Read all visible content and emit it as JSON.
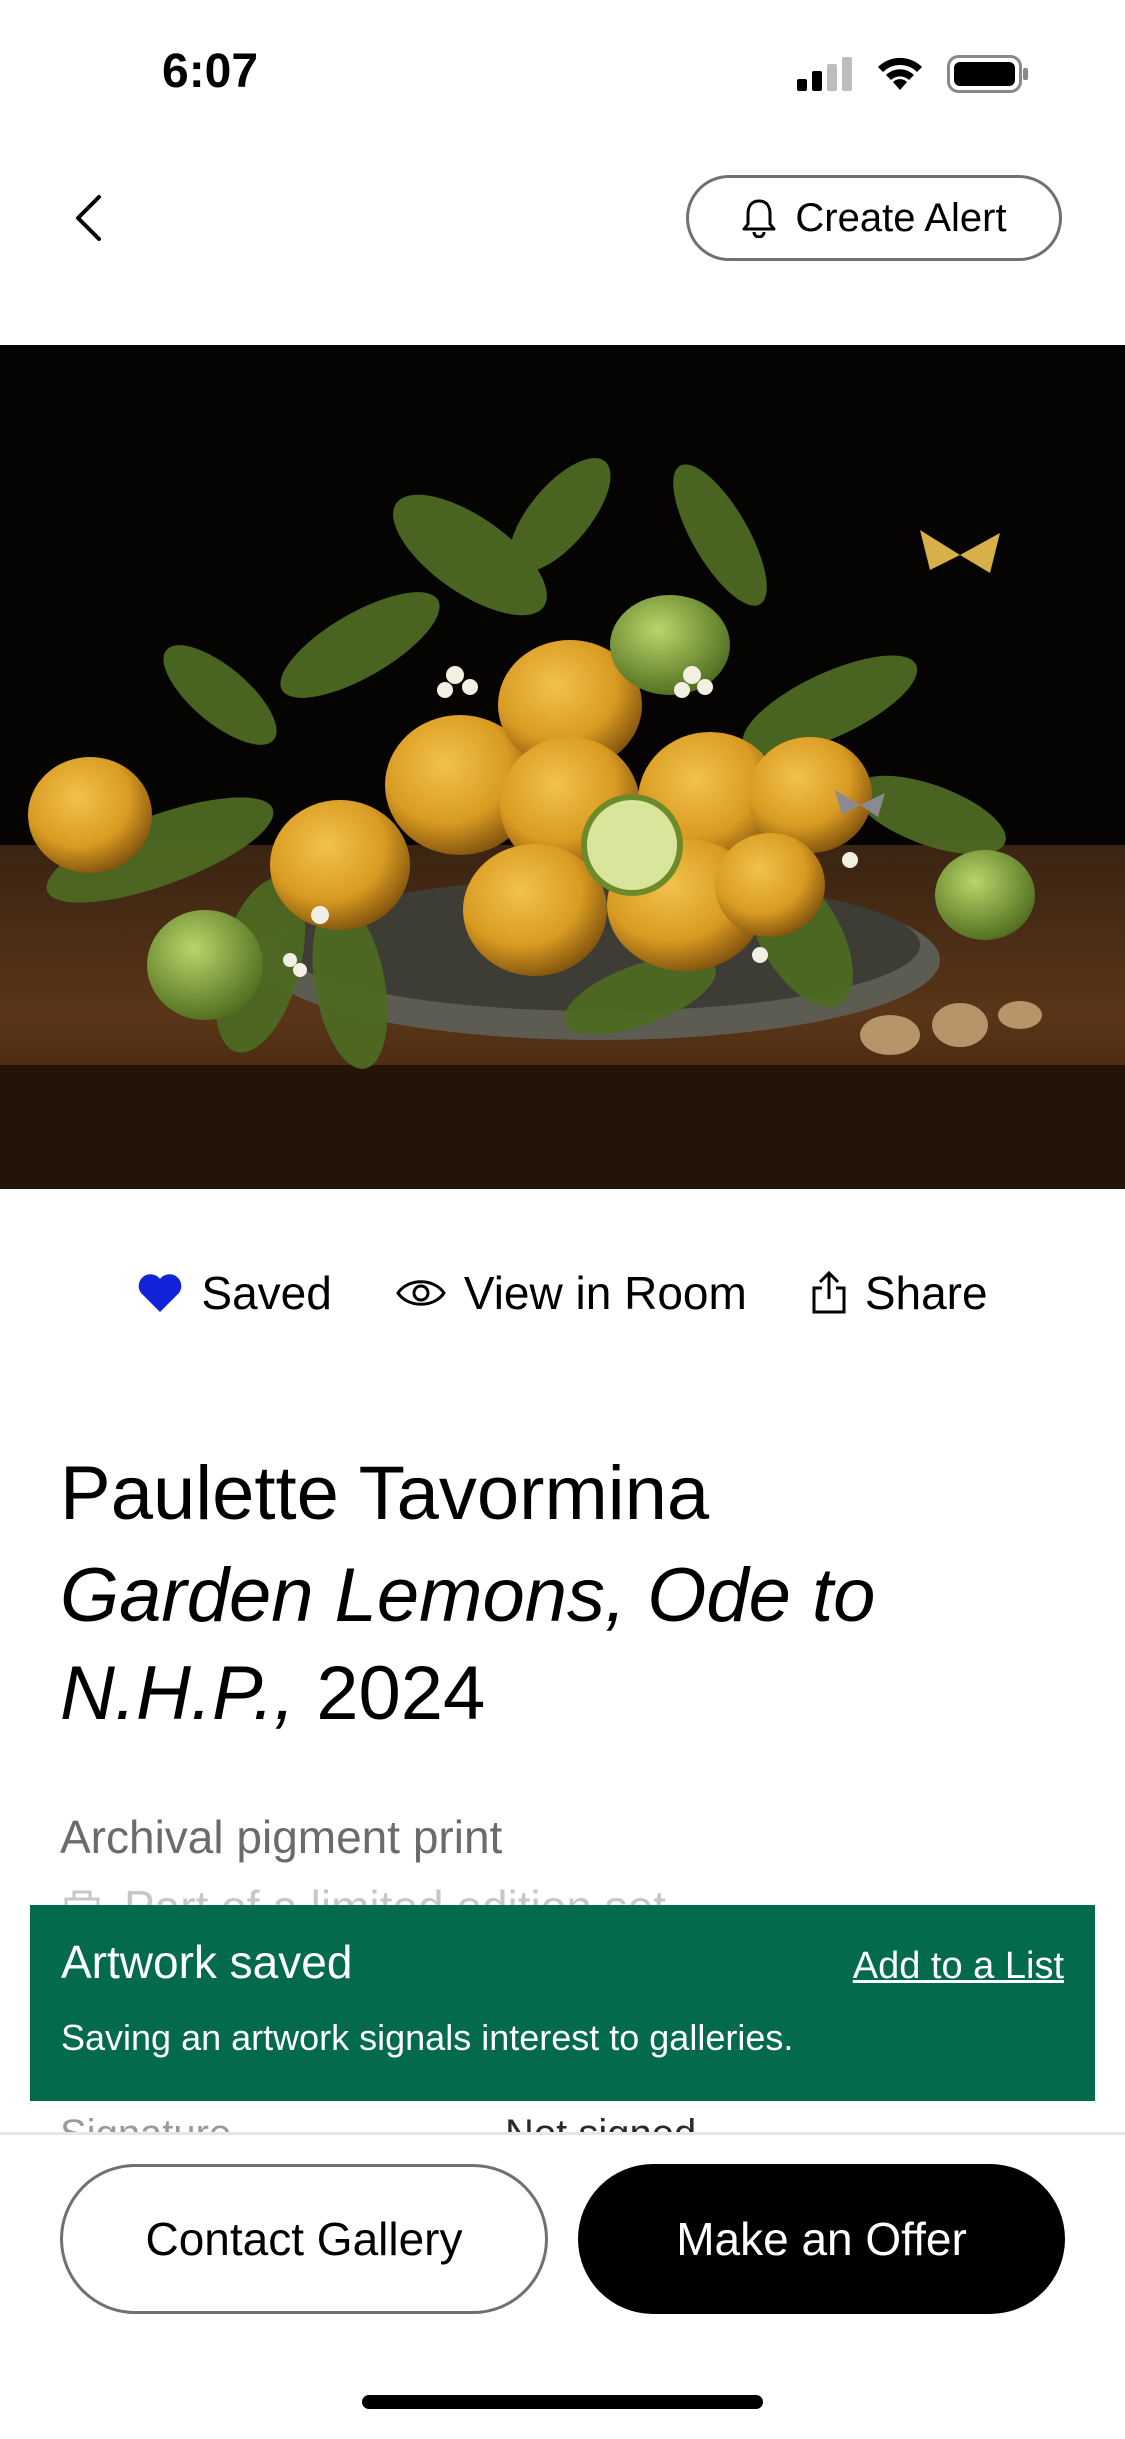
{
  "status_bar": {
    "time": "6:07"
  },
  "nav": {
    "back_icon": "chevron-left-icon",
    "create_alert_label": "Create Alert",
    "alert_icon": "bell-icon"
  },
  "artwork_image": {
    "description": "Still life photo of lemons and leaves on a pewter plate with butterflies, dark background"
  },
  "actions": {
    "saved_label": "Saved",
    "view_in_room_label": "View in Room",
    "share_label": "Share"
  },
  "artwork": {
    "artist": "Paulette Tavormina",
    "title_italic": "Garden Lemons, Ode to N.H.P.,",
    "year": "2024",
    "medium": "Archival pigment print",
    "edition_text": "Part of a limited edition set",
    "signature_label": "Signature",
    "signature_value": "Not signed"
  },
  "toast": {
    "title": "Artwork saved",
    "link": "Add to a List",
    "subtitle": "Saving an artwork signals interest to galleries."
  },
  "bottom_bar": {
    "contact_label": "Contact Gallery",
    "offer_label": "Make an Offer"
  },
  "colors": {
    "toast_bg": "#036a4d",
    "saved_heart": "#1023d7"
  }
}
